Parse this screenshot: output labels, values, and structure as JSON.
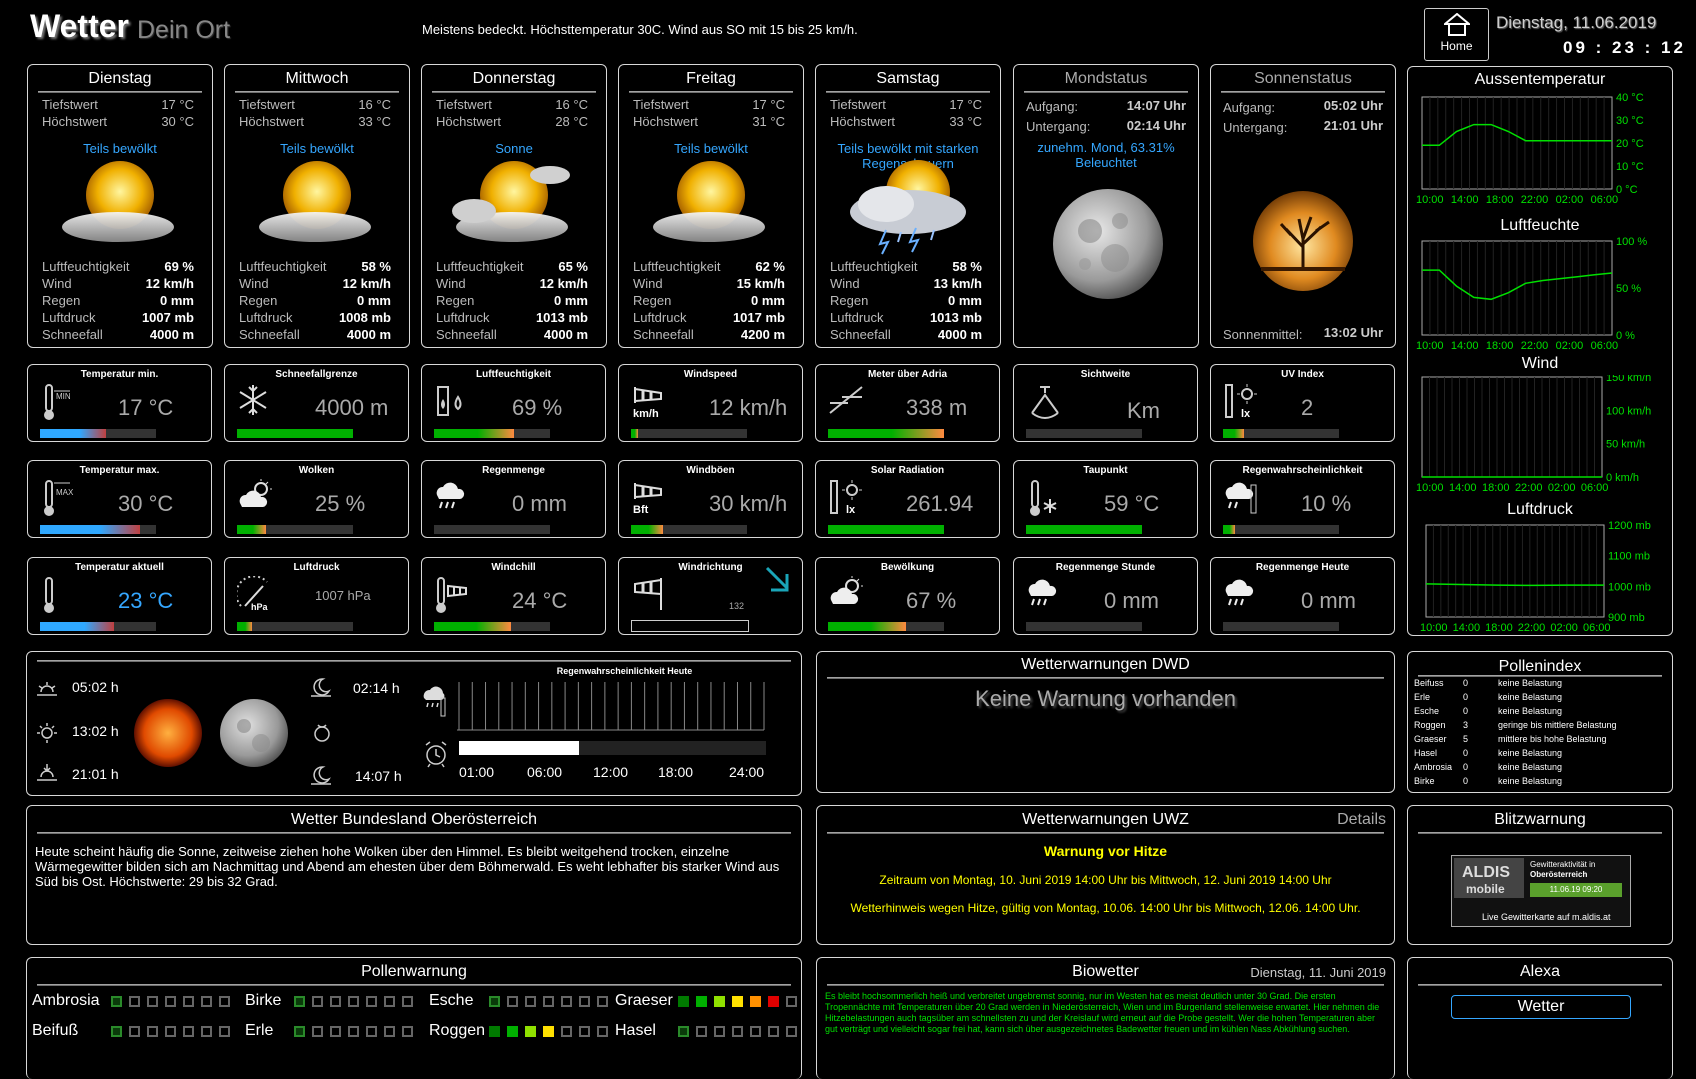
{
  "header": {
    "title": "Wetter",
    "subtitle": "Dein Ort",
    "summary": "Meistens bedeckt. Höchsttemperatur 30C. Wind aus SO mit 15 bis 25 km/h.",
    "home_label": "Home",
    "date": "Dienstag, 11.06.2019",
    "time": "09 : 23 : 12"
  },
  "labels": {
    "min": "Tiefstwert",
    "max": "Höchstwert",
    "hum": "Luftfeuchtigkeit",
    "wind": "Wind",
    "rain": "Regen",
    "press": "Luftdruck",
    "snow": "Schneefall"
  },
  "forecast": [
    {
      "day": "Dienstag",
      "min": "17 °C",
      "max": "30 °C",
      "cond": "Teils bewölkt",
      "hum": "69 %",
      "wind": "12 km/h",
      "rain": "0 mm",
      "press": "1007 mb",
      "snow": "4000 m"
    },
    {
      "day": "Mittwoch",
      "min": "16 °C",
      "max": "33 °C",
      "cond": "Teils bewölkt",
      "hum": "58 %",
      "wind": "12 km/h",
      "rain": "0 mm",
      "press": "1008 mb",
      "snow": "4000 m"
    },
    {
      "day": "Donnerstag",
      "min": "16 °C",
      "max": "28 °C",
      "cond": "Sonne",
      "hum": "65 %",
      "wind": "12 km/h",
      "rain": "0 mm",
      "press": "1013 mb",
      "snow": "4000 m"
    },
    {
      "day": "Freitag",
      "min": "17 °C",
      "max": "31 °C",
      "cond": "Teils bewölkt",
      "hum": "62 %",
      "wind": "15 km/h",
      "rain": "0 mm",
      "press": "1017 mb",
      "snow": "4200 m"
    },
    {
      "day": "Samstag",
      "min": "17 °C",
      "max": "33 °C",
      "cond": "Teils bewölkt mit starken Regenschauern",
      "hum": "58 %",
      "wind": "13 km/h",
      "rain": "0 mm",
      "press": "1013 mb",
      "snow": "4000 m"
    }
  ],
  "moon": {
    "title": "Mondstatus",
    "rise_label": "Aufgang:",
    "rise": "14:07 Uhr",
    "set_label": "Untergang:",
    "set": "02:14 Uhr",
    "phase": "zunehm. Mond, 63.31% Beleuchtet"
  },
  "sun": {
    "title": "Sonnenstatus",
    "rise_label": "Aufgang:",
    "rise": "05:02 Uhr",
    "set_label": "Untergang:",
    "set": "21:01 Uhr",
    "noon_label": "Sonnenmittel:",
    "noon": "13:02 Uhr"
  },
  "tiles": [
    {
      "title": "Temperatur min.",
      "value": "17 °C",
      "fill": 0.57,
      "color": "grad-blue"
    },
    {
      "title": "Schneefallgrenze",
      "value": "4000 m",
      "fill": 1.0,
      "color": "green"
    },
    {
      "title": "Luftfeuchtigkeit",
      "value": "69 %",
      "fill": 0.69,
      "color": "grad-green"
    },
    {
      "title": "Windspeed",
      "value": "12 km/h",
      "fill": 0.06,
      "color": "grad-green"
    },
    {
      "title": "Meter über Adria",
      "value": "338 m",
      "fill": 1.0,
      "color": "grad-green"
    },
    {
      "title": "Sichtweite",
      "value": "Km",
      "fill": 0.0,
      "color": "green"
    },
    {
      "title": "UV Index",
      "value": "2",
      "fill": 0.18,
      "color": "grad-green"
    },
    {
      "title": "Temperatur max.",
      "value": "30 °C",
      "fill": 0.86,
      "color": "grad-blue"
    },
    {
      "title": "Wolken",
      "value": "25 %",
      "fill": 0.25,
      "color": "grad-green"
    },
    {
      "title": "Regenmenge",
      "value": "0 mm",
      "fill": 0.0,
      "color": "green"
    },
    {
      "title": "Windböen",
      "value": "30 km/h",
      "fill": 0.28,
      "color": "grad-green"
    },
    {
      "title": "Solar Radiation",
      "value": "261.94",
      "fill": 1.0,
      "color": "green"
    },
    {
      "title": "Taupunkt",
      "value": "59 °C",
      "fill": 1.0,
      "color": "green"
    },
    {
      "title": "Regenwahrscheinlichkeit",
      "value": "10 %",
      "fill": 0.1,
      "color": "grad-green"
    },
    {
      "title": "Temperatur aktuell",
      "value": "23 °C",
      "fill": 0.64,
      "color": "grad-blue"
    },
    {
      "title": "Luftdruck",
      "value": "1007 hPa",
      "fill": 0.13,
      "color": "grad-green"
    },
    {
      "title": "Windchill",
      "value": "24 °C",
      "fill": 0.66,
      "color": "grad-green"
    },
    {
      "title": "Windrichtung",
      "value": "132",
      "fill": 0.0,
      "color": "none"
    },
    {
      "title": "Bewölkung",
      "value": "67 %",
      "fill": 0.67,
      "color": "grad-green"
    },
    {
      "title": "Regenmenge Stunde",
      "value": "0 mm",
      "fill": 0.0,
      "color": "green"
    },
    {
      "title": "Regenmenge Heute",
      "value": "0 mm",
      "fill": 0.0,
      "color": "green"
    }
  ],
  "charts": {
    "temp": {
      "title": "Aussentemperatur",
      "yticks": [
        "40 °C",
        "30 °C",
        "20 °C",
        "10 °C",
        "0 °C"
      ]
    },
    "hum": {
      "title": "Luftfeuchte",
      "yticks": [
        "100 %",
        "50 %",
        "0 %"
      ]
    },
    "wind": {
      "title": "Wind",
      "yticks": [
        "150 km/h",
        "100 km/h",
        "50 km/h",
        "0 km/h"
      ]
    },
    "press": {
      "title": "Luftdruck",
      "yticks": [
        "1200 mb",
        "1100 mb",
        "1000 mb",
        "900 mb"
      ]
    },
    "xticks": [
      "10:00",
      "14:00",
      "18:00",
      "22:00",
      "02:00",
      "06:00"
    ]
  },
  "chart_data": [
    {
      "type": "line",
      "title": "Aussentemperatur",
      "x": [
        "10:00",
        "12:00",
        "14:00",
        "16:00",
        "18:00",
        "20:00",
        "22:00",
        "00:00",
        "02:00",
        "04:00",
        "06:00",
        "08:00"
      ],
      "ylim": [
        0,
        40
      ],
      "series": [
        {
          "values": [
            19,
            19,
            25,
            28,
            28,
            25,
            21,
            21,
            21,
            21,
            21,
            21
          ]
        }
      ]
    },
    {
      "type": "line",
      "title": "Luftfeuchte",
      "x": [
        "10:00",
        "12:00",
        "14:00",
        "16:00",
        "18:00",
        "20:00",
        "22:00",
        "00:00",
        "02:00",
        "04:00",
        "06:00",
        "08:00"
      ],
      "ylim": [
        0,
        100
      ],
      "series": [
        {
          "values": [
            69,
            69,
            52,
            40,
            38,
            45,
            55,
            58,
            60,
            62,
            64,
            66
          ]
        }
      ]
    },
    {
      "type": "line",
      "title": "Wind",
      "x": [
        "10:00",
        "14:00",
        "18:00",
        "22:00",
        "02:00",
        "06:00"
      ],
      "ylim": [
        0,
        150
      ],
      "series": [
        {
          "values": [
            0,
            0,
            0,
            0,
            0,
            0
          ]
        }
      ]
    },
    {
      "type": "line",
      "title": "Luftdruck",
      "x": [
        "10:00",
        "14:00",
        "18:00",
        "22:00",
        "02:00",
        "06:00"
      ],
      "ylim": [
        900,
        1200
      ],
      "series": [
        {
          "values": [
            1008,
            1006,
            1004,
            1003,
            1004,
            1004
          ]
        }
      ]
    }
  ],
  "astro": {
    "sunrise": "05:02 h",
    "noon": "13:02 h",
    "sunset": "21:01 h",
    "moonset": "02:14 h",
    "moonrise": "14:07 h",
    "rain_title": "Regenwahrscheinlichkeit Heute",
    "hours": [
      "01:00",
      "06:00",
      "12:00",
      "18:00",
      "24:00"
    ],
    "progress": 0.39
  },
  "dwd": {
    "title": "Wetterwarnungen DWD",
    "text": "Keine Warnung vorhanden"
  },
  "pollenindex": {
    "title": "Pollenindex",
    "rows": [
      {
        "name": "Beifuss",
        "val": "0",
        "desc": "keine Belastung"
      },
      {
        "name": "Erle",
        "val": "0",
        "desc": "keine Belastung"
      },
      {
        "name": "Esche",
        "val": "0",
        "desc": "keine Belastung"
      },
      {
        "name": "Roggen",
        "val": "3",
        "desc": "geringe bis mittlere Belastung"
      },
      {
        "name": "Graeser",
        "val": "5",
        "desc": "mittlere bis hohe Belastung"
      },
      {
        "name": "Hasel",
        "val": "0",
        "desc": "keine Belastung"
      },
      {
        "name": "Ambrosia",
        "val": "0",
        "desc": "keine Belastung"
      },
      {
        "name": "Birke",
        "val": "0",
        "desc": "keine Belastung"
      }
    ]
  },
  "bundesland": {
    "title": "Wetter Bundesland Oberösterreich",
    "text": "Heute scheint häufig die Sonne, zeitweise ziehen hohe Wolken über den Himmel. Es bleibt weitgehend trocken, einzelne Wärmegewitter bilden sich am Nachmittag und Abend am ehesten über dem Böhmerwald. Es weht lebhafter bis starker Wind aus Süd bis Ost. Höchstwerte: 29 bis 32 Grad."
  },
  "uwz": {
    "title": "Wetterwarnungen UWZ",
    "details": "Details",
    "headline": "Warnung vor Hitze",
    "period": "Zeitraum von Montag, 10. Juni 2019 14:00 Uhr bis Mittwoch, 12. Juni 2019 14:00 Uhr",
    "hint": "Wetterhinweis wegen Hitze, gültig von Montag, 10.06. 14:00 Uhr bis Mittwoch, 12.06. 14:00 Uhr."
  },
  "blitz": {
    "title": "Blitzwarnung",
    "logo1": "ALDIS",
    "logo2": "mobile",
    "l1": "Gewitteraktivität in",
    "l2": "Oberösterreich",
    "stamp": "11.06.19 09:20",
    "l3": "Live Gewitterkarte auf m.aldis.at"
  },
  "pollenwarn": {
    "title": "Pollenwarnung",
    "items": [
      {
        "name": "Ambrosia",
        "level": 0
      },
      {
        "name": "Birke",
        "level": 0
      },
      {
        "name": "Esche",
        "level": 0
      },
      {
        "name": "Graeser",
        "level": 5
      },
      {
        "name": "Beifuß",
        "level": 0
      },
      {
        "name": "Erle",
        "level": 0
      },
      {
        "name": "Roggen",
        "level": 3
      },
      {
        "name": "Hasel",
        "level": 0
      }
    ]
  },
  "bio": {
    "title": "Biowetter",
    "date": "Dienstag, 11. Juni 2019",
    "text": "Es bleibt hochsommerlich heiß und verbreitet ungebremst sonnig, nur im Westen hat es meist deutlich unter 30 Grad. Die ersten Tropennächte mit Temperaturen über 20 Grad werden in Niederösterreich, Wien und im Burgenland stellenweise erwartet. Hier nehmen die Hitzebelastungen auch tagsüber am schnellsten zu und der Kreislauf wird erneut auf die Probe gestellt. Wer die hohen Temperaturen aber gut verträgt und vielleicht sogar frei hat, kann sich über ausgezeichnetes Badewetter freuen und im kühlen Nass Abkühlung suchen."
  },
  "alexa": {
    "title": "Alexa",
    "button": "Wetter"
  },
  "colors": {
    "accent_blue": "#35a7ff",
    "green": "#00c000",
    "yellow": "#ffff00",
    "panel_border": "#d8d8d8"
  }
}
